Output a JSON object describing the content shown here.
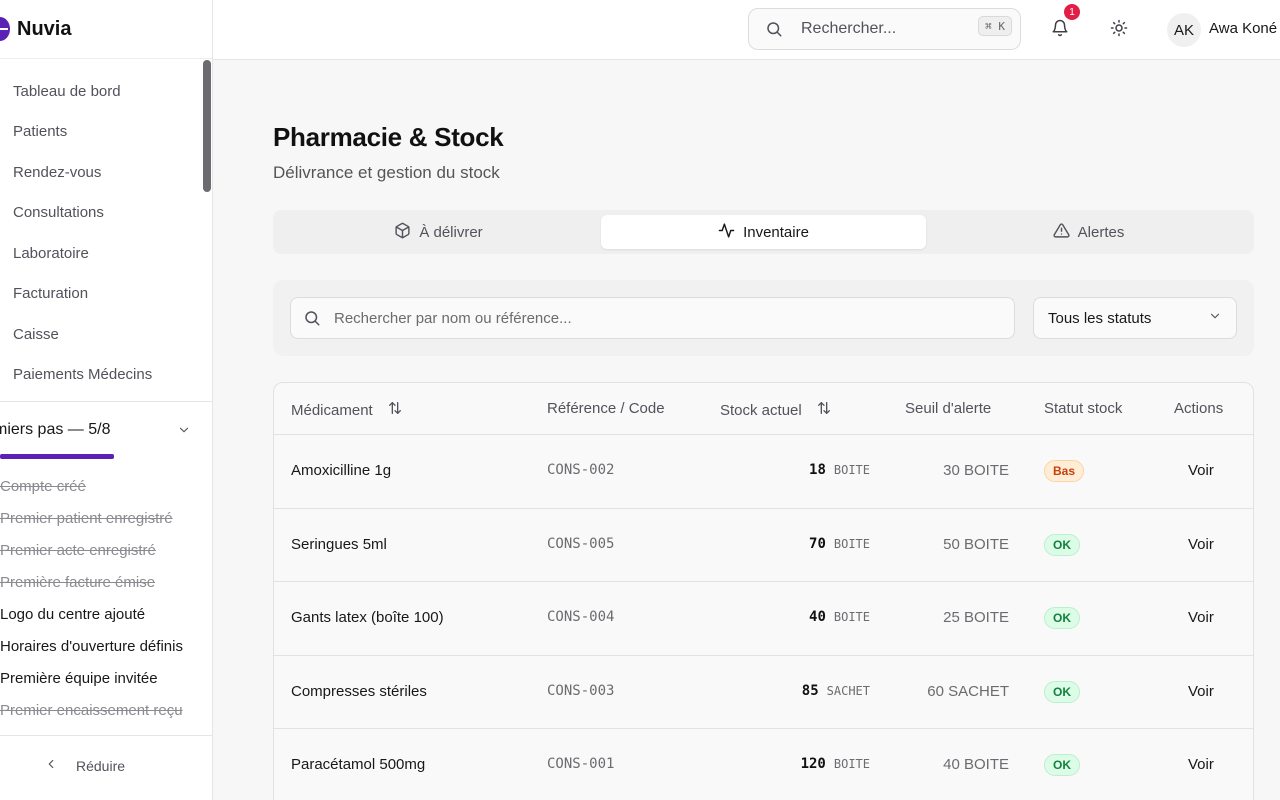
{
  "brand": {
    "name": "Nuvia"
  },
  "sidebar": {
    "items": [
      {
        "label": "Tableau de bord"
      },
      {
        "label": "Patients"
      },
      {
        "label": "Rendez-vous"
      },
      {
        "label": "Consultations"
      },
      {
        "label": "Laboratoire"
      },
      {
        "label": "Facturation"
      },
      {
        "label": "Caisse"
      },
      {
        "label": "Paiements Médecins"
      }
    ],
    "onboarding": {
      "title": "miers pas — 5/8",
      "progress": 0.625,
      "steps": [
        {
          "label": "Compte créé",
          "done": true
        },
        {
          "label": "Premier patient enregistré",
          "done": true
        },
        {
          "label": "Premier acte enregistré",
          "done": true
        },
        {
          "label": "Première facture émise",
          "done": true
        },
        {
          "label": "Logo du centre ajouté",
          "done": false
        },
        {
          "label": "Horaires d'ouverture définis",
          "done": false
        },
        {
          "label": "Première équipe invitée",
          "done": false
        },
        {
          "label": "Premier encaissement reçu",
          "done": true
        }
      ]
    },
    "collapse_label": "Réduire"
  },
  "header": {
    "search_placeholder": "Rechercher...",
    "shortcut": "⌘ K",
    "notifications_count": "1",
    "user_initials": "AK",
    "user_name": "Awa Koné"
  },
  "page": {
    "title": "Pharmacie & Stock",
    "subtitle": "Délivrance et gestion du stock"
  },
  "tabs": [
    {
      "label": "À délivrer",
      "icon": "package-icon"
    },
    {
      "label": "Inventaire",
      "icon": "activity-icon",
      "active": true
    },
    {
      "label": "Alertes",
      "icon": "alert-triangle-icon"
    }
  ],
  "filters": {
    "search_placeholder": "Rechercher par nom ou référence...",
    "status_value": "Tous les statuts"
  },
  "table": {
    "columns": [
      "Médicament",
      "Référence / Code",
      "Stock actuel",
      "Seuil d'alerte",
      "Statut stock",
      "Actions"
    ],
    "rows": [
      {
        "name": "Amoxicilline 1g",
        "ref": "CONS-002",
        "stock": "18",
        "unit": "BOITE",
        "threshold": "30 BOITE",
        "status": "Bas",
        "action": "Voir"
      },
      {
        "name": "Seringues 5ml",
        "ref": "CONS-005",
        "stock": "70",
        "unit": "BOITE",
        "threshold": "50 BOITE",
        "status": "OK",
        "action": "Voir"
      },
      {
        "name": "Gants latex (boîte 100)",
        "ref": "CONS-004",
        "stock": "40",
        "unit": "BOITE",
        "threshold": "25 BOITE",
        "status": "OK",
        "action": "Voir"
      },
      {
        "name": "Compresses stériles",
        "ref": "CONS-003",
        "stock": "85",
        "unit": "SACHET",
        "threshold": "60 SACHET",
        "status": "OK",
        "action": "Voir"
      },
      {
        "name": "Paracétamol 500mg",
        "ref": "CONS-001",
        "stock": "120",
        "unit": "BOITE",
        "threshold": "40 BOITE",
        "status": "OK",
        "action": "Voir"
      }
    ]
  },
  "colors": {
    "brand": "#5b21b6",
    "ok_bg": "#dcfce7",
    "ok_text": "#15803d",
    "low_bg": "#ffedd5",
    "low_text": "#c2410c",
    "badge": "#e11d48"
  }
}
